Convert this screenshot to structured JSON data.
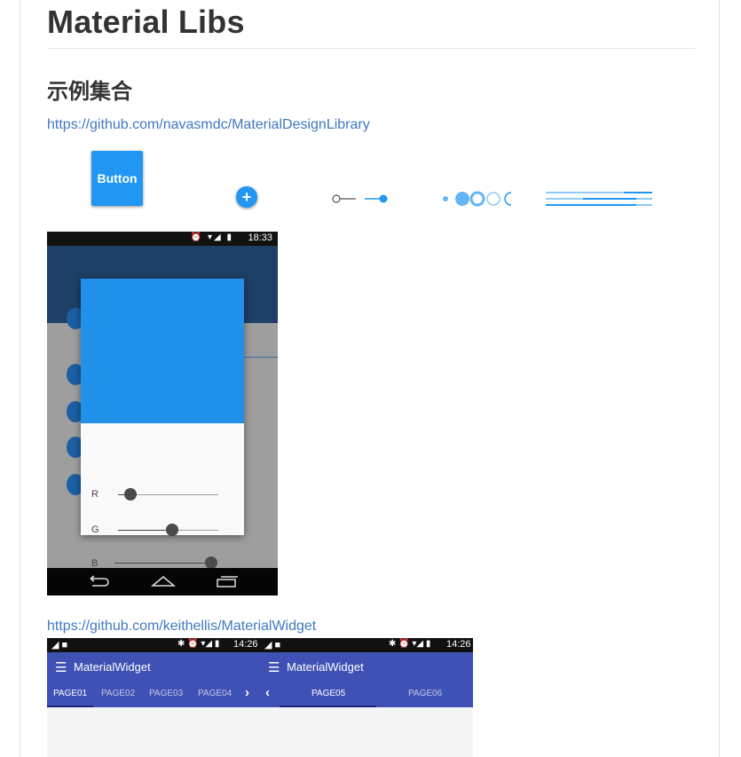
{
  "heading": "Material Libs",
  "subheading": "示例集合",
  "links": {
    "first": "https://github.com/navasmdc/MaterialDesignLibrary",
    "second": "https://github.com/keithellis/MaterialWidget"
  },
  "demo": {
    "button_label": "Button",
    "fab_icon": "+"
  },
  "phone1": {
    "time": "18:33",
    "status_icons": "⏰ ▾◢ ▮",
    "sliders": [
      {
        "label": "R",
        "value": 0.1
      },
      {
        "label": "G",
        "value": 0.55
      },
      {
        "label": "B",
        "value": 0.93
      }
    ],
    "nav_icons": [
      "back-icon",
      "home-icon",
      "recents-icon"
    ]
  },
  "phone2": {
    "time_left": "14:26",
    "time_right": "14:26",
    "title_left": "MaterialWidget",
    "title_right": "MaterialWidget",
    "tabs_left": [
      "PAGE01",
      "PAGE02",
      "PAGE03",
      "PAGE04"
    ],
    "tabs_right": [
      "PAGE05",
      "PAGE06"
    ]
  },
  "colors": {
    "link": "#4078c0",
    "accent": "#2196f3",
    "indigo": "#3f51b5"
  }
}
